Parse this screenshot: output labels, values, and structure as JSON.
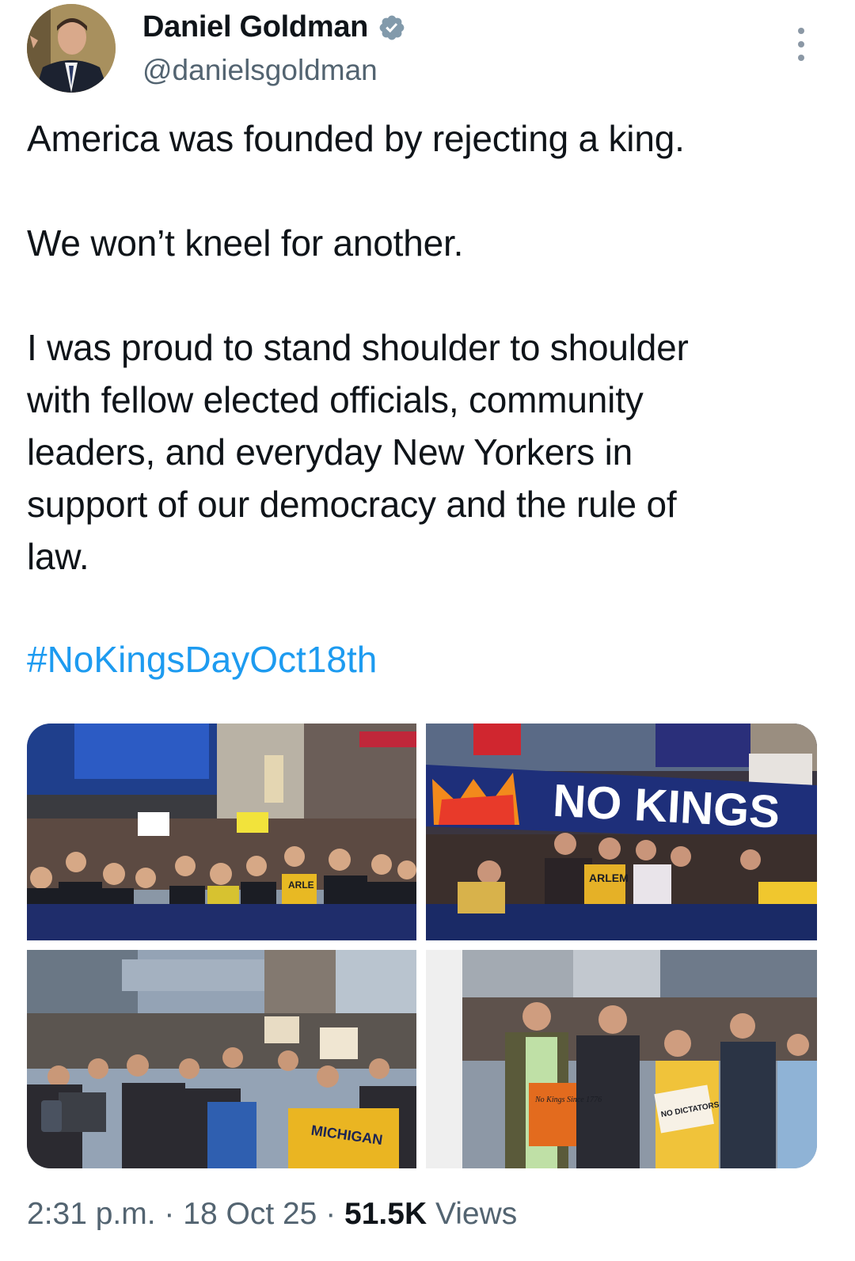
{
  "author": {
    "display_name": "Daniel Goldman",
    "handle": "@danielsgoldman",
    "verified": true
  },
  "tweet": {
    "text": "America was founded by rejecting a king.\n\nWe won’t kneel for another.\n\nI was proud to stand shoulder to shoulder\nwith fellow elected officials, community\nleaders, and everyday New Yorkers in\nsupport of our democracy and the rule of\nlaw.",
    "hashtag": "#NoKingsDayOct18th"
  },
  "photos": [
    {
      "name": "march-photo-1",
      "sign_text": "ARLE"
    },
    {
      "name": "march-photo-2",
      "banner_text": "NO KINGS",
      "sign_text": "ARLEM"
    },
    {
      "name": "march-photo-3",
      "sign_text": "MICHIGAN"
    },
    {
      "name": "march-photo-4",
      "sign_text_1": "No Kings Since 1776",
      "sign_text_2": "NO DICTATORS"
    }
  ],
  "footer": {
    "time": "2:31 p.m.",
    "separator": " · ",
    "date": "18 Oct 25",
    "views_count": "51.5K",
    "views_label": " Views"
  },
  "colors": {
    "link": "#1d9bf0",
    "secondary_text": "#536471",
    "verified_badge": "#829aab"
  }
}
